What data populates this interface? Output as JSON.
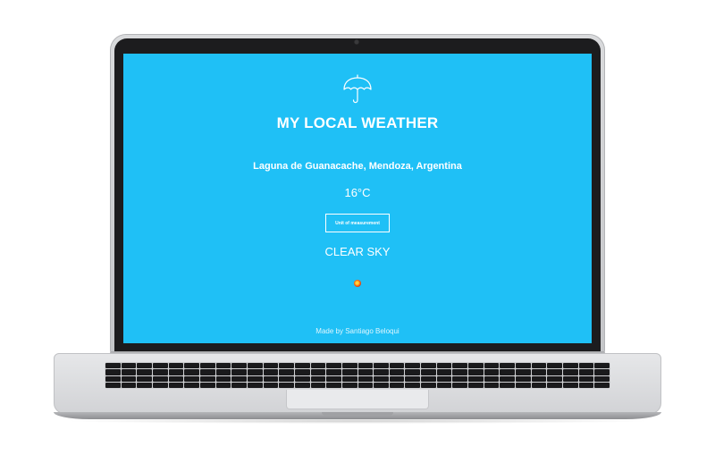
{
  "app": {
    "title": "MY LOCAL WEATHER",
    "icon": "umbrella-icon"
  },
  "weather": {
    "location": "Laguna de Guanacache, Mendoza, Argentina",
    "temperature": "16°C",
    "condition": "CLEAR SKY",
    "condition_icon": "clear-sky-sun-icon"
  },
  "controls": {
    "unit_button_label": "Unit of measurement"
  },
  "footer": {
    "credit": "Made by Santiago Beloqui"
  },
  "colors": {
    "background": "#1fc0f6",
    "text": "#ffffff"
  }
}
